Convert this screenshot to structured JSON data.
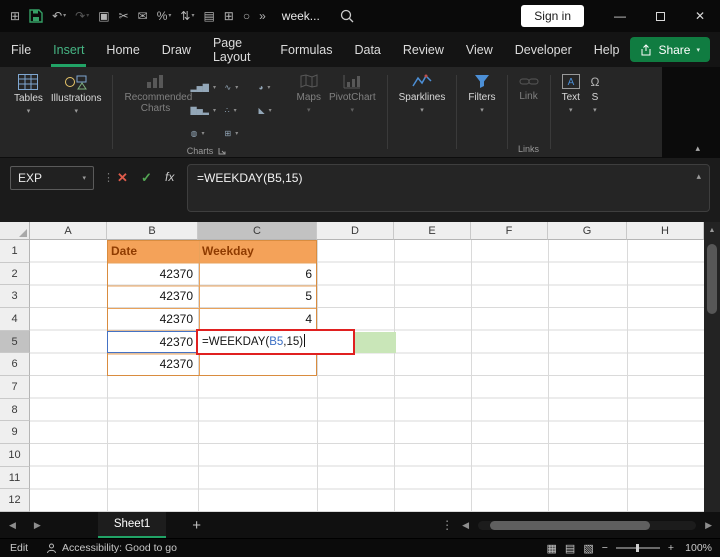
{
  "window": {
    "doc_name": "week...",
    "sign_in": "Sign in"
  },
  "menu": {
    "items": [
      "File",
      "Insert",
      "Home",
      "Draw",
      "Page Layout",
      "Formulas",
      "Data",
      "Review",
      "View",
      "Developer",
      "Help"
    ],
    "active": "Insert",
    "share": "Share"
  },
  "ribbon": {
    "tables": "Tables",
    "illustrations": "Illustrations",
    "recommended_charts": "Recommended Charts",
    "maps": "Maps",
    "pivotchart": "PivotChart",
    "sparklines": "Sparklines",
    "filters": "Filters",
    "link": "Link",
    "text_btn": "Text",
    "symbols_partial": "S",
    "charts_group_label": "Charts",
    "links_group_label": "Links"
  },
  "formula_bar": {
    "name_box": "EXP",
    "fx": "fx",
    "formula": "=WEEKDAY(B5,15)"
  },
  "grid": {
    "col_headers": [
      "A",
      "B",
      "C",
      "D",
      "E",
      "F",
      "G",
      "H"
    ],
    "row_headers": [
      "1",
      "2",
      "3",
      "4",
      "5",
      "6",
      "7",
      "8",
      "9",
      "10",
      "11",
      "12"
    ],
    "cells": {
      "B1": "Date",
      "C1": "Weekday",
      "B2": "42370",
      "C2": "6",
      "B3": "42370",
      "C3": "5",
      "B4": "42370",
      "C4": "4",
      "B5": "42370",
      "B6": "42370"
    },
    "editing": {
      "prefix": "=WEEKDAY(",
      "ref": "B5",
      "suffix": ",15)"
    }
  },
  "sheet_bar": {
    "tabs": [
      "Sheet1"
    ]
  },
  "status_bar": {
    "mode": "Edit",
    "accessibility": "Accessibility: Good to go",
    "zoom": "100%"
  },
  "colors": {
    "excel_green": "#107C41",
    "tab_underline_green": "#21A366",
    "orange_fill": "#F4A259",
    "orange_text": "#8F3B00",
    "orange_border": "#DD8A3C",
    "ref_blue": "#3B6FC4",
    "annotation_red": "#E02020",
    "highlight_green": "#C9E6B8"
  }
}
